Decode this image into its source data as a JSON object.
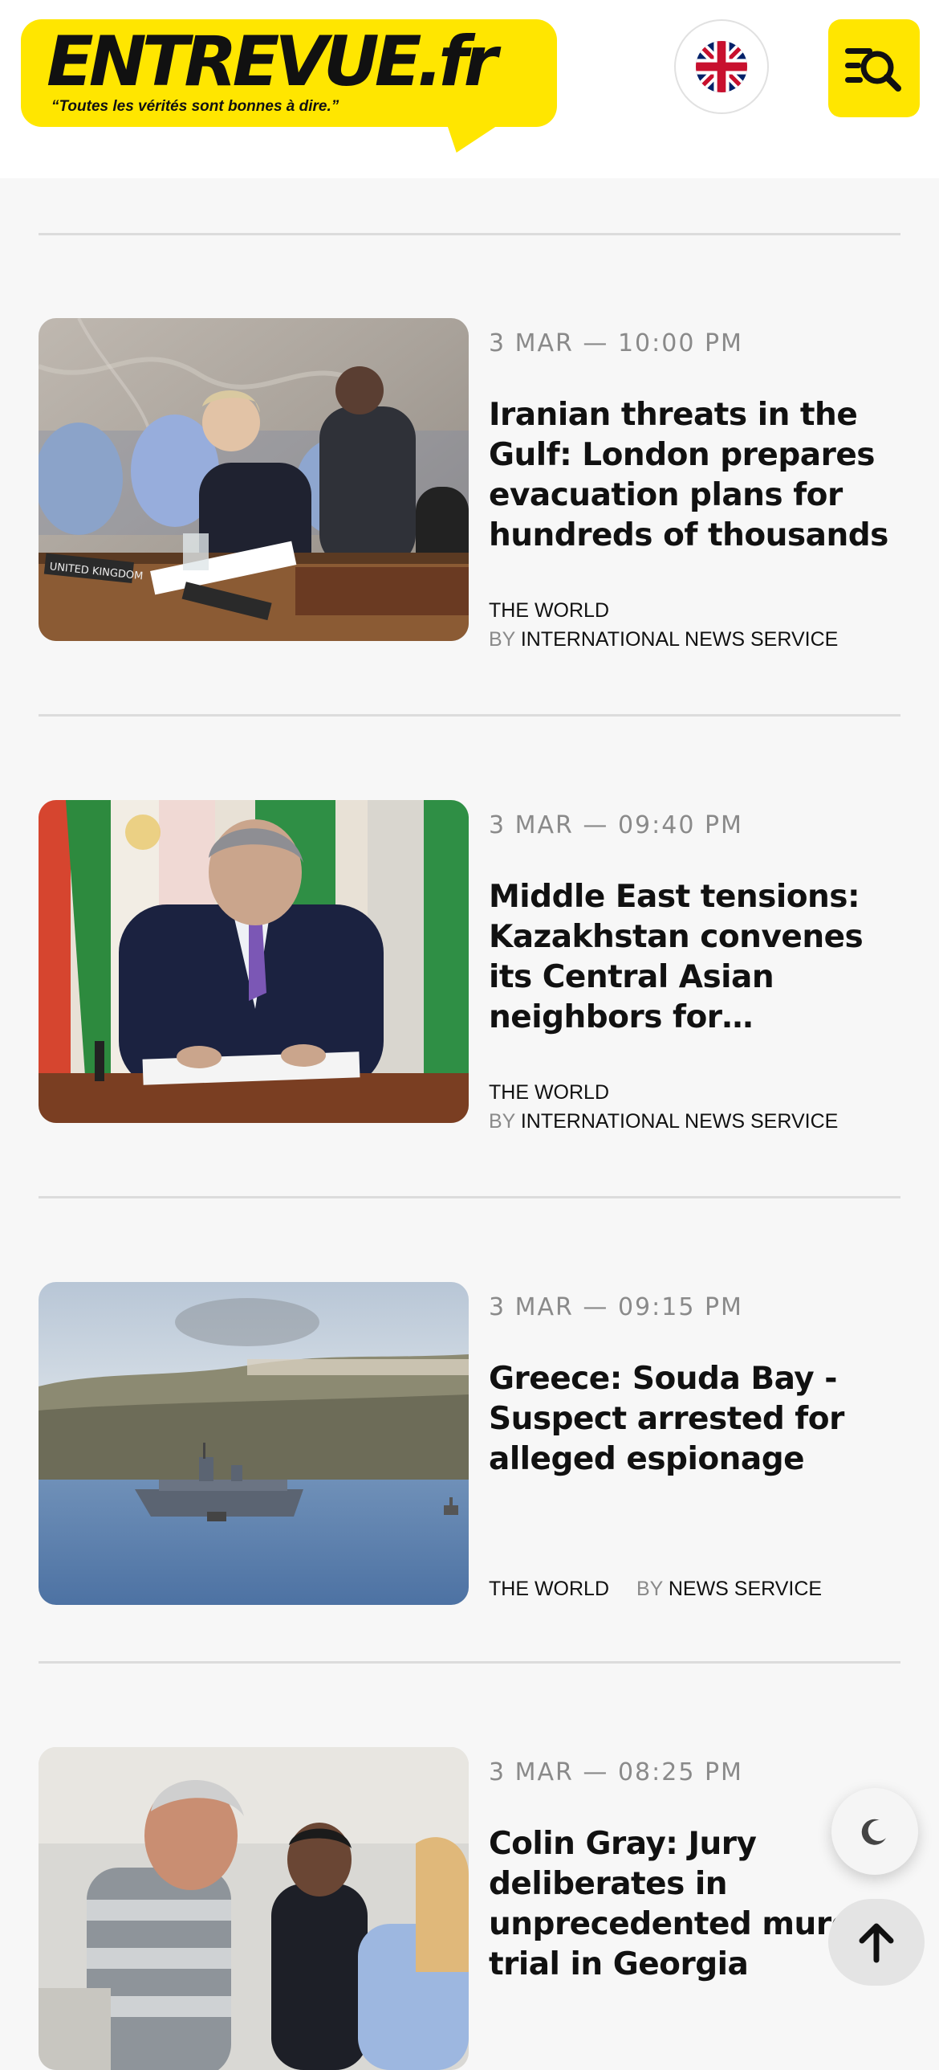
{
  "header": {
    "logo_text": "ENTREVUE.fr",
    "tagline": "“Toutes les vérités sont bonnes à dire.”",
    "language_icon": "uk-flag-icon",
    "menu_icon": "menu-search-icon",
    "brand_color": "#ffe600"
  },
  "articles": [
    {
      "date": "3 MAR — 10:00 PM",
      "title": "Iranian threats in the Gulf: London prepares evacuation plans for hundreds of thousands",
      "category": "THE WORLD",
      "by": "BY",
      "author": "INTERNATIONAL NEWS SERVICE"
    },
    {
      "date": "3 MAR — 09:40 PM",
      "title": "Middle East tensions: Kazakhstan convenes its Central Asian neighbors for consultations",
      "category": "THE WORLD",
      "by": "BY",
      "author": "INTERNATIONAL NEWS SERVICE"
    },
    {
      "date": "3 MAR — 09:15 PM",
      "title": "Greece: Souda Bay - Suspect arrested for alleged espionage",
      "category": "THE WORLD",
      "by": "BY",
      "author": "NEWS SERVICE"
    },
    {
      "date": "3 MAR — 08:25 PM",
      "title": "Colin Gray: Jury deliberates in unprecedented murder trial in Georgia",
      "category": "",
      "by": "",
      "author": ""
    }
  ],
  "floating": {
    "dark_mode_icon": "moon-icon",
    "scroll_top_icon": "arrow-up-icon"
  }
}
